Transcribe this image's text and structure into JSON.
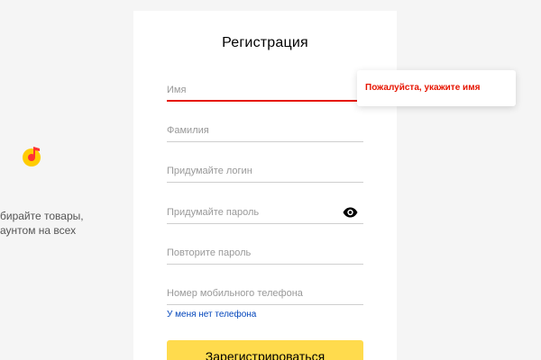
{
  "colors": {
    "error": "#e61400",
    "accent_yellow": "#ffdb4d",
    "link": "#0044bb",
    "card_bg": "#ffffff",
    "page_bg": "#f5f5f5"
  },
  "promo": {
    "logo_icon": "yandex-music-icon",
    "text_line1": "бирайте товары,",
    "text_line2": "аунтом на всех"
  },
  "form": {
    "title": "Регистрация",
    "first_name": {
      "placeholder": "Имя",
      "value": ""
    },
    "last_name": {
      "placeholder": "Фамилия",
      "value": ""
    },
    "login": {
      "placeholder": "Придумайте логин",
      "value": ""
    },
    "password": {
      "placeholder": "Придумайте пароль",
      "value": "",
      "icon": "eye-icon"
    },
    "password_repeat": {
      "placeholder": "Повторите пароль",
      "value": ""
    },
    "phone": {
      "placeholder": "Номер мобильного телефона",
      "value": ""
    },
    "no_phone_link": "У меня нет телефона",
    "submit_label": "Зарегистрироваться"
  },
  "tooltip": {
    "error_text": "Пожалуйста, укажите имя"
  }
}
